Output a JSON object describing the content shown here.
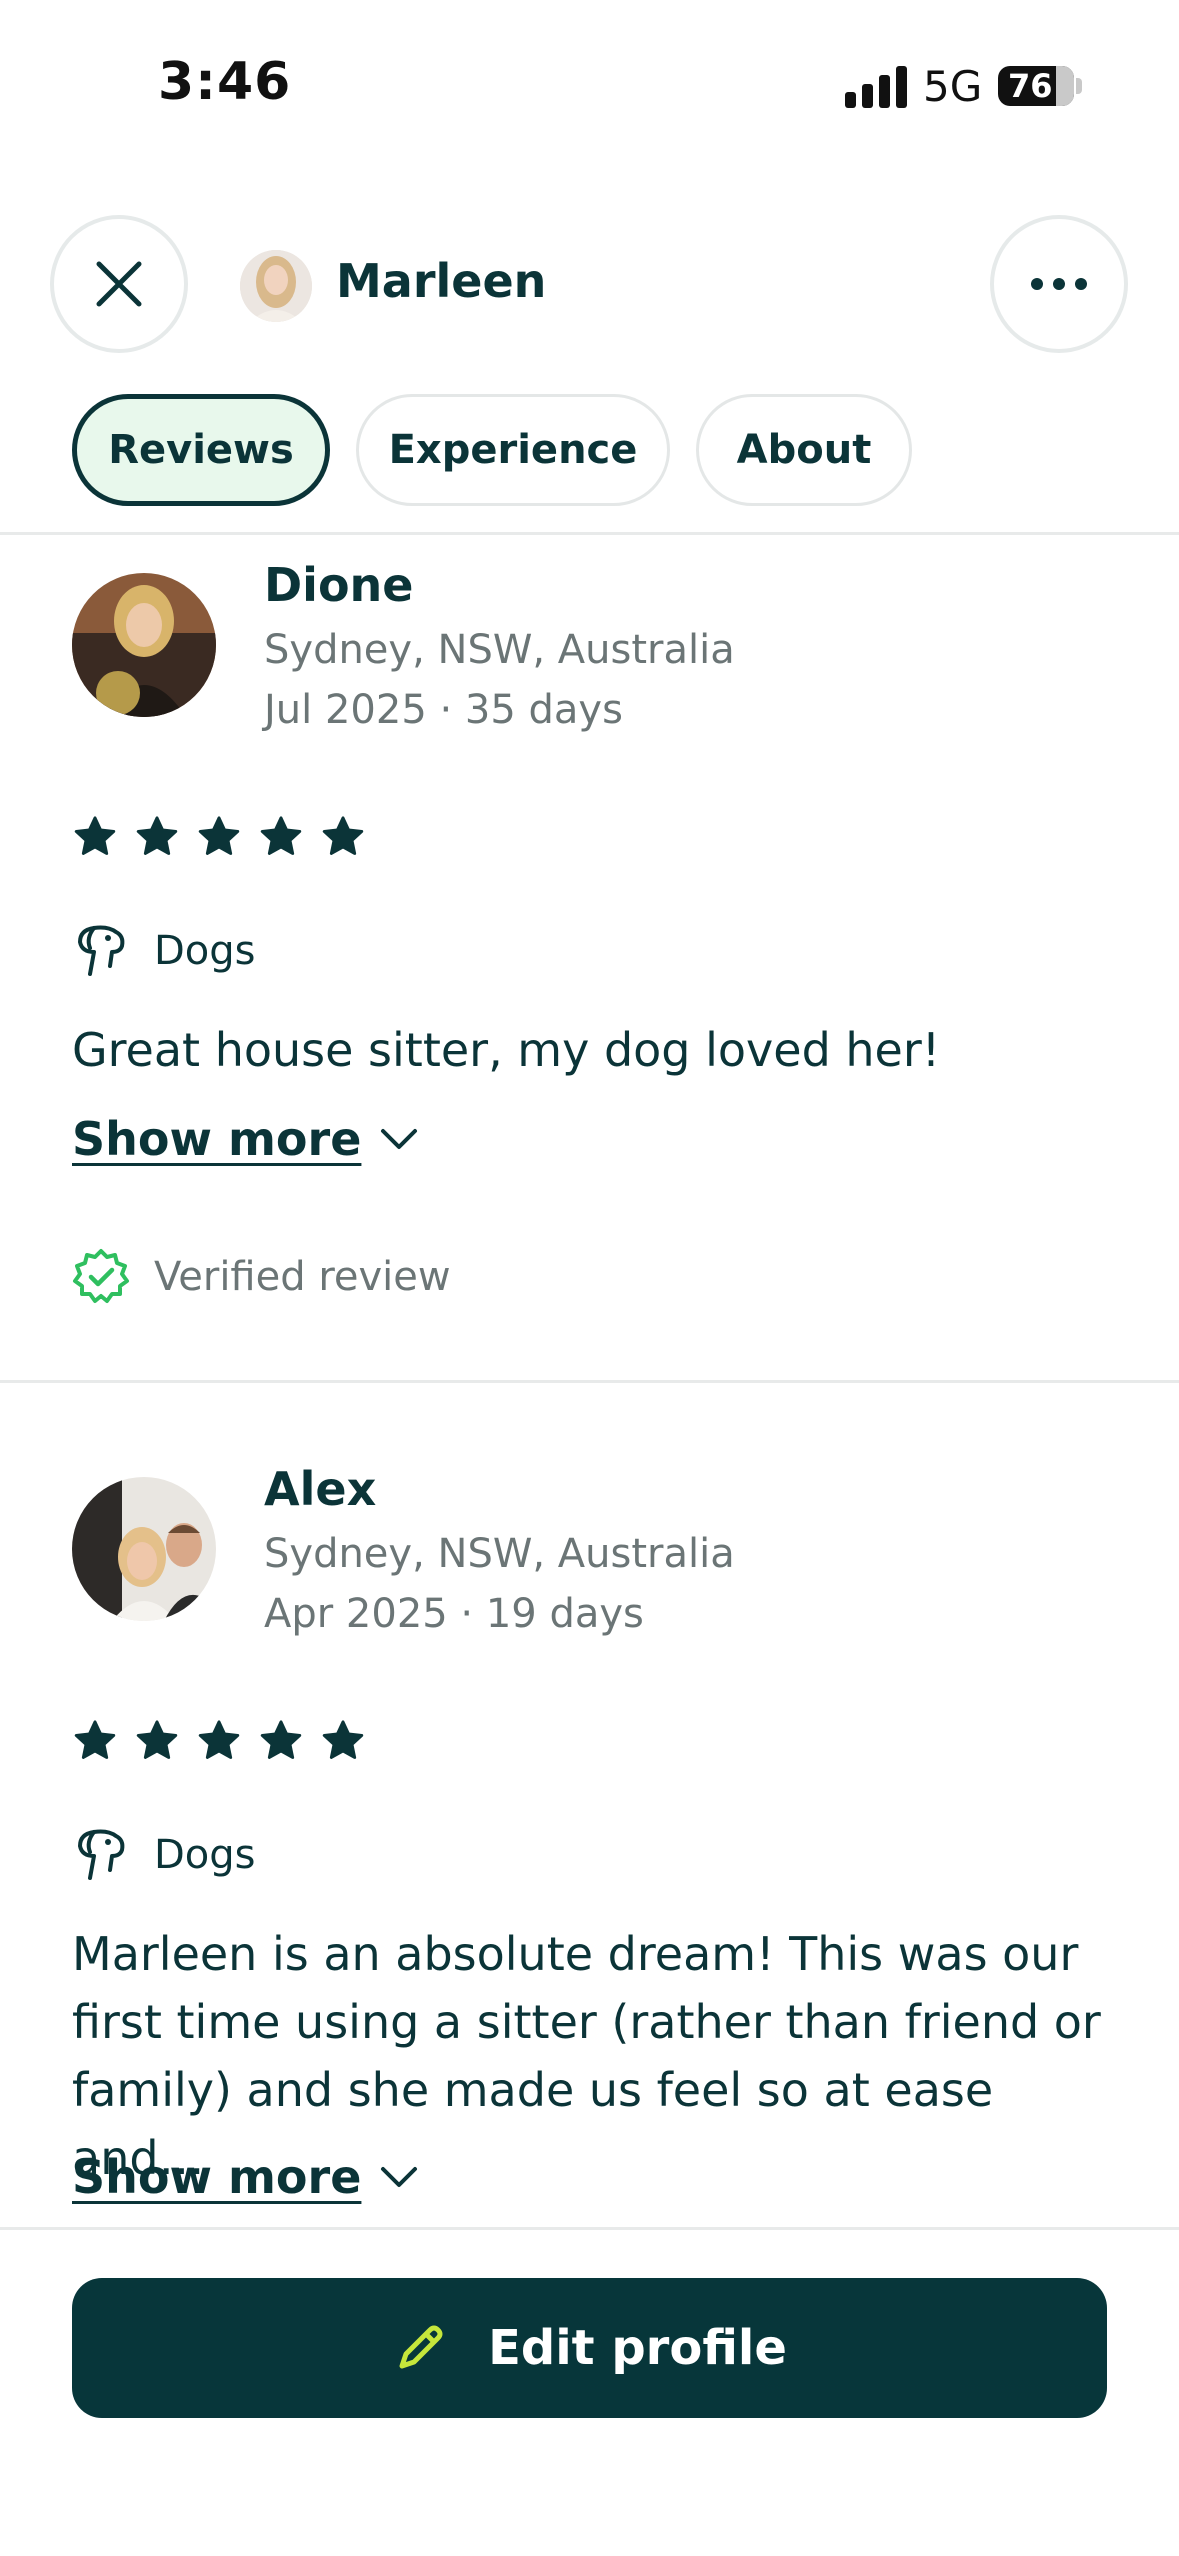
{
  "status_bar": {
    "time": "3:46",
    "network": "5G",
    "battery": "76"
  },
  "header": {
    "name": "Marleen",
    "close_icon": "close-icon",
    "more_icon": "more-horizontal-icon"
  },
  "tabs": [
    {
      "label": "Reviews",
      "active": true
    },
    {
      "label": "Experience",
      "active": false
    },
    {
      "label": "About",
      "active": false
    }
  ],
  "reviews": [
    {
      "name": "Dione",
      "location": "Sydney, NSW, Australia",
      "date_duration": "Jul 2025 · 35 days",
      "rating": 5,
      "pet": "Dogs",
      "text": "Great house sitter, my dog loved her!",
      "show_more": "Show more",
      "verified": "Verified review"
    },
    {
      "name": "Alex",
      "location": "Sydney, NSW, Australia",
      "date_duration": "Apr 2025 · 19 days",
      "rating": 5,
      "pet": "Dogs",
      "text": "Marleen is an absolute dream! This was our first time using a sitter (rather than friend or family) and she made us feel so at ease and…",
      "show_more": "Show more"
    }
  ],
  "footer": {
    "edit_label": "Edit profile"
  },
  "colors": {
    "brand_dark": "#07363a",
    "accent_green": "#2fbf5f",
    "pencil": "#c6e63b",
    "active_tab_bg": "#e8f8ec"
  }
}
